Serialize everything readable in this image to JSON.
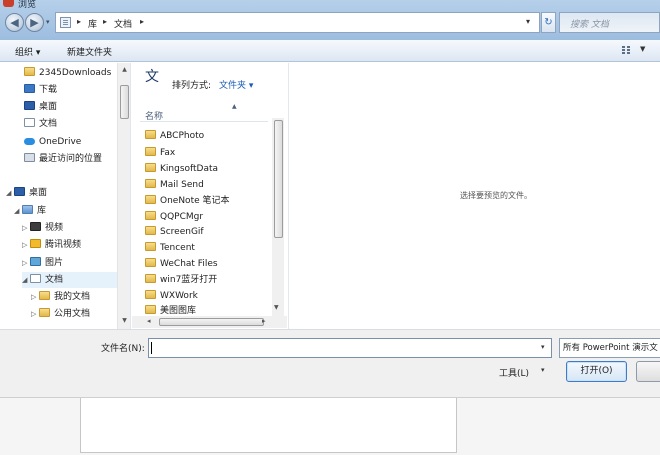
{
  "window": {
    "title": "浏览"
  },
  "address": {
    "crumbs": [
      "库",
      "文档"
    ],
    "separator": "▸",
    "search_placeholder": "搜索 文档"
  },
  "toolbar": {
    "organize_label": "组织 ▾",
    "new_folder_label": "新建文件夹"
  },
  "nav": {
    "items": [
      {
        "label": "2345Downloads",
        "icon": "folder-icon"
      },
      {
        "label": "下载",
        "icon": "download-folder-icon"
      },
      {
        "label": "桌面",
        "icon": "desktop-icon"
      },
      {
        "label": "文档",
        "icon": "documents-icon"
      },
      {
        "label": "OneDrive",
        "icon": "onedrive-cloud-icon"
      },
      {
        "label": "最近访问的位置",
        "icon": "recent-places-icon"
      },
      {
        "label": "桌面",
        "icon": "desktop-icon"
      },
      {
        "label": "库",
        "icon": "library-icon"
      },
      {
        "label": "视频",
        "icon": "video-library-icon"
      },
      {
        "label": "腾讯视频",
        "icon": "tencent-video-icon"
      },
      {
        "label": "图片",
        "icon": "pictures-library-icon"
      },
      {
        "label": "文档",
        "icon": "documents-icon"
      },
      {
        "label": "我的文档",
        "icon": "folder-icon"
      },
      {
        "label": "公用文档",
        "icon": "folder-icon"
      }
    ]
  },
  "library": {
    "title": "文",
    "arrange_label": "排列方式:",
    "arrange_value": "文件夹 ▾",
    "column_name": "名称",
    "files": [
      "ABCPhoto",
      "Fax",
      "KingsoftData",
      "Mail Send",
      "OneNote 笔记本",
      "QQPCMgr",
      "ScreenGif",
      "Tencent",
      "WeChat Files",
      "win7蓝牙打开",
      "WXWork",
      "美图图库"
    ]
  },
  "preview": {
    "message": "选择要预览的文件。"
  },
  "bottom": {
    "filename_label": "文件名(N):",
    "filename_value": "",
    "filetype_value": "所有 PowerPoint 演示文",
    "tools_label": "工具(L)",
    "open_label": "打开(O)",
    "cancel_label": ""
  },
  "colors": {
    "titlebar": "#a9c6e4",
    "link_blue": "#1a5bb5",
    "folder_yellow": "#e3b94a",
    "open_button_border": "#3d7bc6"
  }
}
